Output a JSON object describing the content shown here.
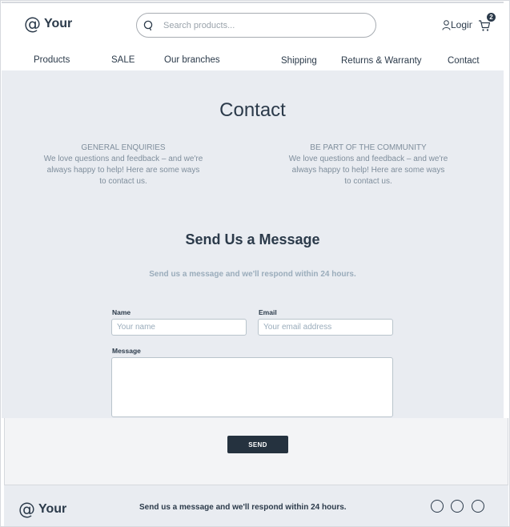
{
  "header": {
    "logo_symbol": "@",
    "logo_text": "Your",
    "search": {
      "placeholder": "Search products..."
    },
    "login_label": "Login",
    "cart_count": "2",
    "nav": [
      "Products",
      "SALE",
      "Our branches",
      "Shipping",
      "Returns & Warranty",
      "Contact"
    ]
  },
  "main": {
    "title": "Contact",
    "info_left": {
      "heading": "GENERAL ENQUIRIES",
      "body": "We love questions and feedback – and we're always happy to help! Here are some ways to contact us."
    },
    "info_right": {
      "heading": "BE PART OF THE COMMUNITY",
      "body": "We love questions and feedback – and we're always happy to help! Here are some ways to contact us."
    },
    "form_title": "Send Us a Message",
    "form_subtitle": "Send us a message and we'll respond within 24 hours.",
    "form": {
      "name_label": "Name",
      "name_placeholder": "Your name",
      "email_label": "Email",
      "email_placeholder": "Your email address",
      "message_label": "Message",
      "message_placeholder": "",
      "send_label": "SEND"
    }
  },
  "footer": {
    "logo_symbol": "@",
    "logo_text": "Your",
    "text": "Send us a message and we'll respond within 24 hours.",
    "social_icons": [
      "social-icon-1",
      "social-icon-2",
      "social-icon-3"
    ]
  },
  "colors": {
    "primary_dark": "#25323f",
    "text": "#2b3a4a",
    "muted": "#7f8e9c",
    "background": "#e9ecf1"
  }
}
